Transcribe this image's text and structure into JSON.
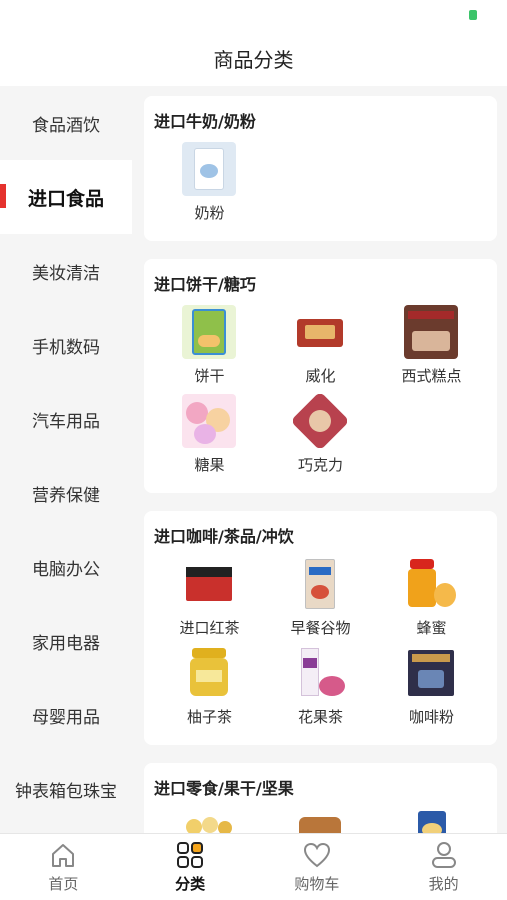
{
  "header": {
    "title": "商品分类"
  },
  "sidebar": {
    "items": [
      {
        "label": "食品酒饮"
      },
      {
        "label": "进口食品"
      },
      {
        "label": "美妆清洁"
      },
      {
        "label": "手机数码"
      },
      {
        "label": "汽车用品"
      },
      {
        "label": "营养保健"
      },
      {
        "label": "电脑办公"
      },
      {
        "label": "家用电器"
      },
      {
        "label": "母婴用品"
      },
      {
        "label": "钟表箱包珠宝"
      }
    ],
    "active_index": 1
  },
  "sections": [
    {
      "title": "进口牛奶/奶粉",
      "items": [
        {
          "label": "奶粉",
          "icon": "milk-powder-icon",
          "color": "#dfe9f3"
        }
      ]
    },
    {
      "title": "进口饼干/糖巧",
      "items": [
        {
          "label": "饼干",
          "icon": "biscuit-icon",
          "color": "#8fc04a"
        },
        {
          "label": "威化",
          "icon": "wafer-icon",
          "color": "#b23a2a"
        },
        {
          "label": "西式糕点",
          "icon": "pastry-icon",
          "color": "#6b3b2d"
        },
        {
          "label": "糖果",
          "icon": "candy-icon",
          "color": "#f2a7c3"
        },
        {
          "label": "巧克力",
          "icon": "chocolate-icon",
          "color": "#b8424e"
        }
      ]
    },
    {
      "title": "进口咖啡/茶品/冲饮",
      "items": [
        {
          "label": "进口红茶",
          "icon": "black-tea-icon",
          "color": "#c9302c"
        },
        {
          "label": "早餐谷物",
          "icon": "cereal-icon",
          "color": "#e9d9c6"
        },
        {
          "label": "蜂蜜",
          "icon": "honey-icon",
          "color": "#f0a21b"
        },
        {
          "label": "柚子茶",
          "icon": "citron-tea-icon",
          "color": "#e9c23a"
        },
        {
          "label": "花果茶",
          "icon": "fruit-tea-icon",
          "color": "#d65a8a"
        },
        {
          "label": "咖啡粉",
          "icon": "coffee-powder-icon",
          "color": "#2f2f4a"
        }
      ]
    },
    {
      "title": "进口零食/果干/坚果",
      "items": [
        {
          "label": "",
          "icon": "snack-icon",
          "color": "#f1cf6a"
        },
        {
          "label": "",
          "icon": "dried-fruit-icon",
          "color": "#b9763a"
        },
        {
          "label": "",
          "icon": "nuts-icon",
          "color": "#2b5aa8"
        }
      ]
    }
  ],
  "tabbar": {
    "items": [
      {
        "label": "首页",
        "icon": "home-icon"
      },
      {
        "label": "分类",
        "icon": "category-icon"
      },
      {
        "label": "购物车",
        "icon": "heart-cart-icon"
      },
      {
        "label": "我的",
        "icon": "profile-icon"
      }
    ],
    "active_index": 1
  },
  "colors": {
    "accent": "#e5322d",
    "sidebar_bg": "#f5f5f5",
    "battery": "#3cc46a"
  }
}
